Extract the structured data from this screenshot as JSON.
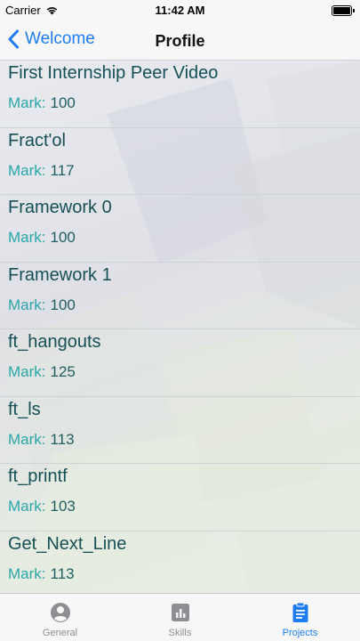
{
  "status_bar": {
    "carrier": "Carrier",
    "time": "11:42 AM",
    "wifi_icon": "wifi-icon",
    "battery_icon": "battery-icon"
  },
  "nav_bar": {
    "back_label": "Welcome",
    "back_icon": "chevron-left-icon",
    "title": "Profile"
  },
  "projects": {
    "mark_label": "Mark:",
    "items": [
      {
        "name": "First Internship Peer Video",
        "mark": "100"
      },
      {
        "name": "Fract'ol",
        "mark": "117"
      },
      {
        "name": "Framework 0",
        "mark": "100"
      },
      {
        "name": "Framework 1",
        "mark": "100"
      },
      {
        "name": "ft_hangouts",
        "mark": "125"
      },
      {
        "name": "ft_ls",
        "mark": "113"
      },
      {
        "name": "ft_printf",
        "mark": "103"
      },
      {
        "name": "Get_Next_Line",
        "mark": "113"
      }
    ]
  },
  "tab_bar": {
    "tabs": [
      {
        "label": "General",
        "icon": "person-icon",
        "active": false
      },
      {
        "label": "Skills",
        "icon": "bar-chart-icon",
        "active": false
      },
      {
        "label": "Projects",
        "icon": "clipboard-icon",
        "active": true
      }
    ]
  },
  "colors": {
    "accent": "#1e7cf2",
    "title_text": "#155057",
    "mark_label": "#2aa7a9",
    "mark_value": "#1f5f63",
    "inactive_tab": "#8e8e93"
  }
}
